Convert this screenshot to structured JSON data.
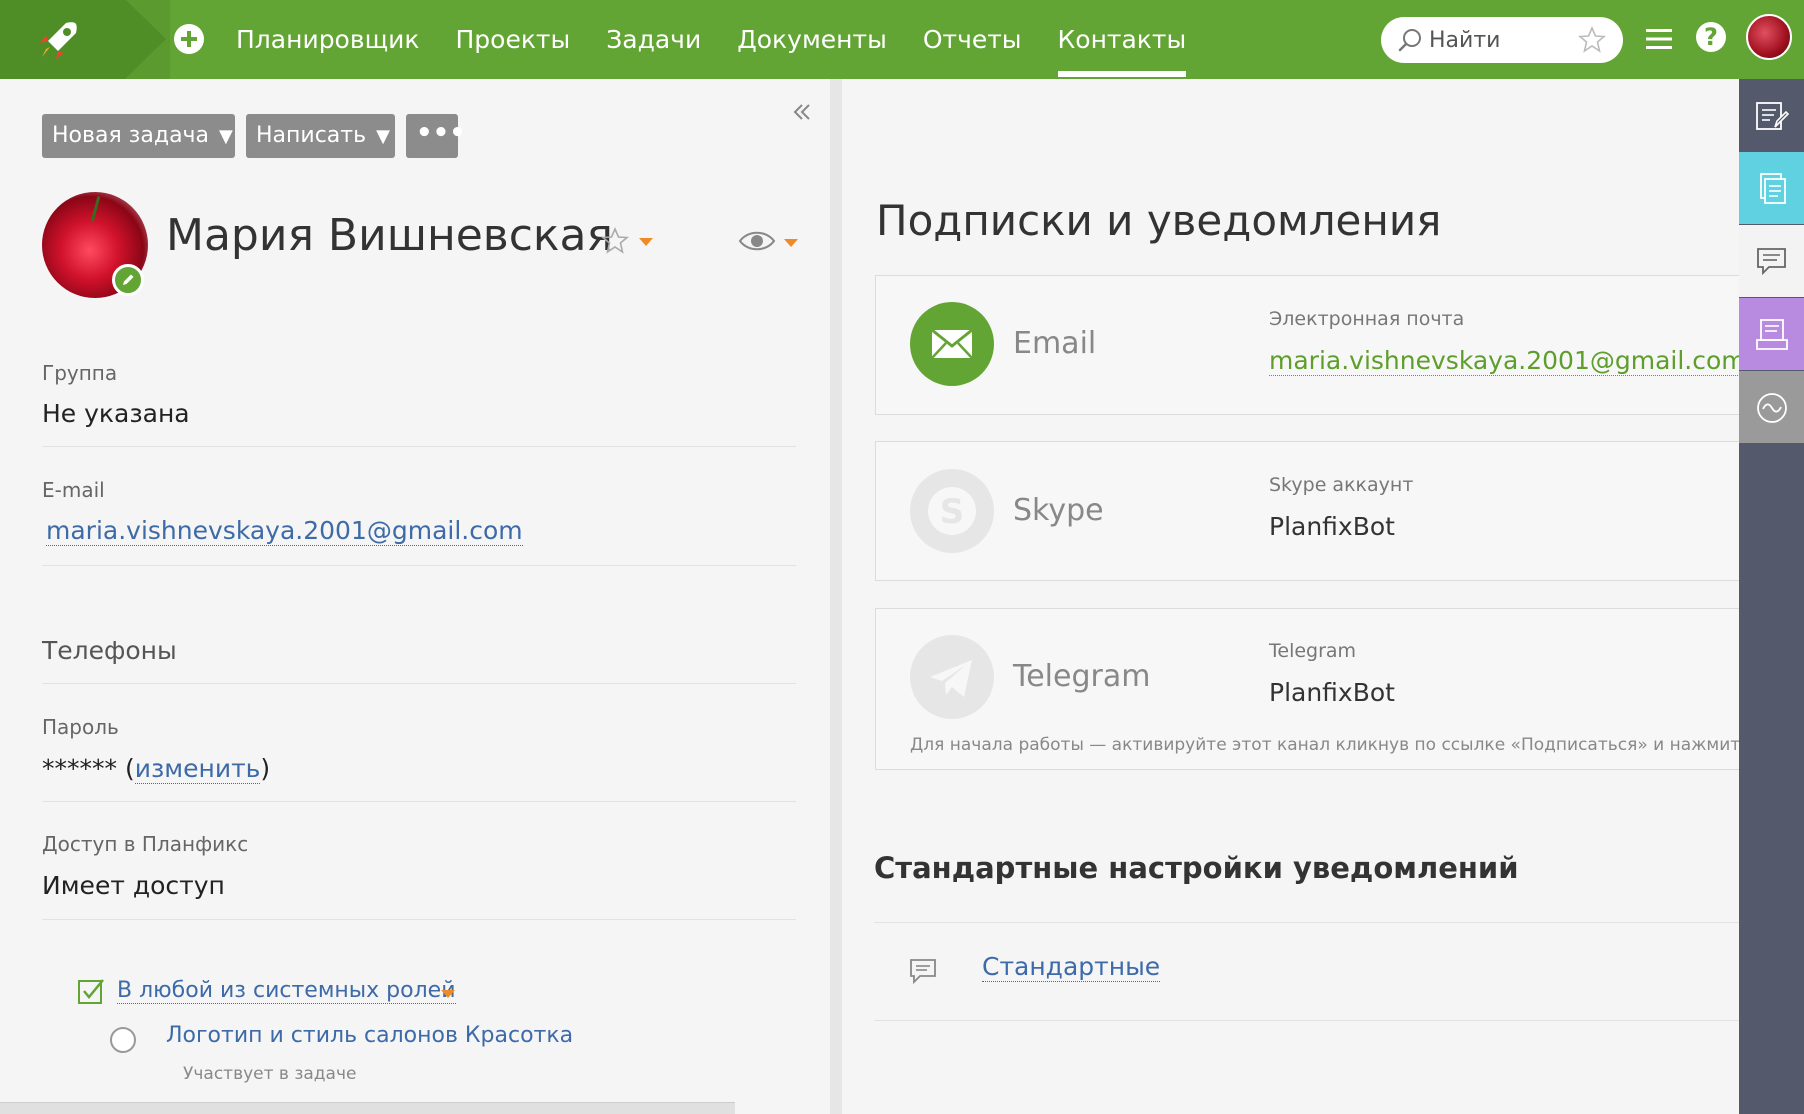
{
  "topbar": {
    "nav": [
      "Планировщик",
      "Проекты",
      "Задачи",
      "Документы",
      "Отчеты",
      "Контакты"
    ],
    "active_nav": "Контакты",
    "search_placeholder": "Найти",
    "help_glyph": "?"
  },
  "toolbar": {
    "new_task": "Новая задача",
    "write": "Написать",
    "more": "•••",
    "caret": "▼"
  },
  "profile": {
    "name": "Мария Вишневская",
    "fields": {
      "group_label": "Группа",
      "group_value": "Не указана",
      "email_label": "E-mail",
      "email_value": "maria.vishnevskaya.2001@gmail.com",
      "phones_title": "Телефоны",
      "password_label": "Пароль",
      "password_mask": "******",
      "password_change": "изменить",
      "access_label": "Доступ в Планфикс",
      "access_value": "Имеет доступ"
    },
    "roles_link": "В любой из системных ролей",
    "task_link": "Логотип и стиль салонов Красотка",
    "task_sub": "Участвует в задаче"
  },
  "subscriptions": {
    "title": "Подписки и уведомления",
    "channels": [
      {
        "name": "Email",
        "label": "Электронная почта",
        "value": "maria.vishnevskaya.2001@gmail.com"
      },
      {
        "name": "Skype",
        "label": "Skype аккаунт",
        "value": "PlanfixBot"
      },
      {
        "name": "Telegram",
        "label": "Telegram",
        "value": "PlanfixBot"
      }
    ],
    "telegram_note": "Для начала работы — активируйте этот канал кликнув по ссылке «Подписаться» и нажмите",
    "std_title": "Стандартные настройки уведомлений",
    "std_link": "Стандартные"
  },
  "colors": {
    "brand_green": "#63a534",
    "link_blue": "#3d6aa8",
    "accent_orange": "#f08a24",
    "sidebar_dark": "#545a6b",
    "sidebar_cyan": "#5fd1e0",
    "sidebar_purple": "#b98be0"
  },
  "icons": [
    "rocket-logo-icon",
    "plus-icon",
    "search-icon",
    "star-icon",
    "menu-icon",
    "help-icon",
    "collapse-icon",
    "pencil-icon",
    "eye-icon",
    "envelope-icon",
    "skype-icon",
    "telegram-icon",
    "chat-icon",
    "checkbox-icon",
    "radio-icon"
  ]
}
